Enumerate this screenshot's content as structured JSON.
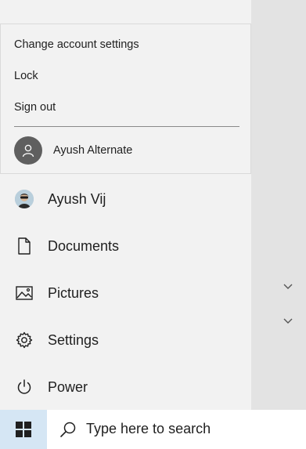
{
  "account_popup": {
    "items": [
      {
        "label": "Change account settings"
      },
      {
        "label": "Lock"
      },
      {
        "label": "Sign out"
      }
    ],
    "alternate_user": {
      "name": "Ayush Alternate",
      "icon": "person-icon"
    }
  },
  "start_menu": {
    "items": [
      {
        "label": "Ayush Vij",
        "icon": "user-avatar"
      },
      {
        "label": "Documents",
        "icon": "document-icon"
      },
      {
        "label": "Pictures",
        "icon": "pictures-icon"
      },
      {
        "label": "Settings",
        "icon": "gear-icon"
      },
      {
        "label": "Power",
        "icon": "power-icon"
      }
    ]
  },
  "taskbar": {
    "start_icon": "windows-logo-icon",
    "search": {
      "placeholder": "Type here to search",
      "icon": "search-icon"
    }
  },
  "colors": {
    "pane_bg": "#f2f2f2",
    "right_area_bg": "#e3e3e3",
    "start_button_bg": "#d5e6f4",
    "text": "#1f1f1f"
  }
}
